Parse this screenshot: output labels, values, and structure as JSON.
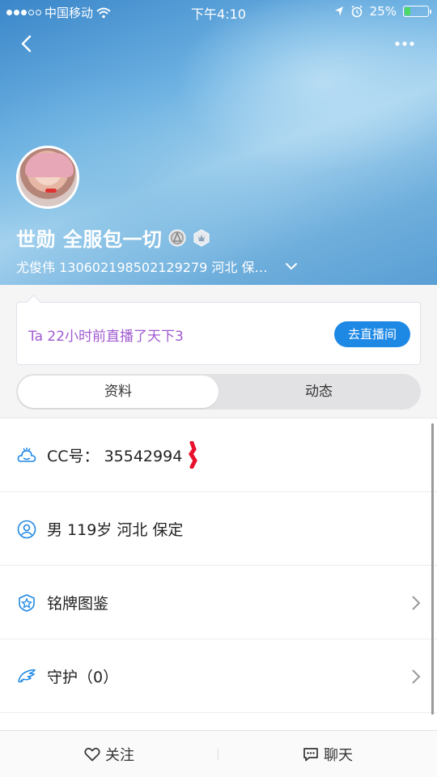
{
  "status_bar": {
    "carrier": "中国移动",
    "time": "下午4:10",
    "battery_percent": "25%",
    "battery_level": 0.25,
    "icons": [
      "signal-dots",
      "wifi-icon",
      "location-arrow-icon",
      "alarm-clock-icon",
      "battery-icon"
    ]
  },
  "header": {
    "back_icon": "chevron-left-icon",
    "more_icon": "more-dots-icon",
    "name": "世勋 全服包一切",
    "subtitle": "尤俊伟 130602198502129279 河北 保…",
    "badges": [
      "level-badge-icon",
      "crown-badge-icon"
    ]
  },
  "live_card": {
    "text": "Ta 22小时前直播了天下3",
    "button_label": "去直播间",
    "accent_color": "#1e88e5",
    "text_color": "#a05ad0"
  },
  "tabs": [
    {
      "label": "资料",
      "active": true
    },
    {
      "label": "动态",
      "active": false
    }
  ],
  "profile_rows": [
    {
      "icon": "cc-cloud-icon",
      "label": "CC号：  35542994"
    },
    {
      "icon": "user-circle-icon",
      "label": "男   119岁   河北 保定"
    },
    {
      "icon": "medal-badge-icon",
      "label": "铭牌图鉴"
    },
    {
      "icon": "wing-icon",
      "label": "守护（0）"
    }
  ],
  "bottom_bar": {
    "follow_label": "关注",
    "chat_label": "聊天"
  }
}
